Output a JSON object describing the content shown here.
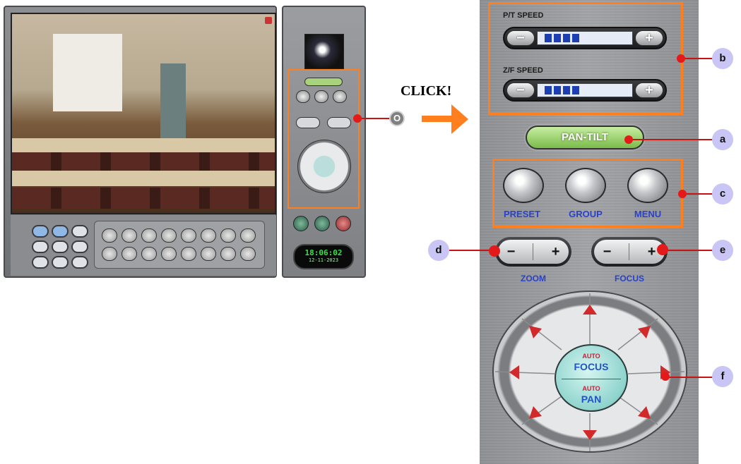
{
  "annotation": {
    "click_label": "CLICK!",
    "o_marker": "O",
    "markers": {
      "a": "a",
      "b": "b",
      "c": "c",
      "d": "d",
      "e": "e",
      "f": "f"
    },
    "colors": {
      "highlight": "#ff7f1f",
      "callout": "#e41a1a",
      "marker_bg": "#c9c5f4",
      "arrow": "#ff7f1f"
    }
  },
  "viewer": {
    "clock_time": "18:06:02",
    "clock_date": "12-11-2023"
  },
  "control_panel": {
    "pt_speed_label": "P/T SPEED",
    "zf_speed_label": "Z/F SPEED",
    "minus": "−",
    "plus": "+",
    "pt_speed_level": 0.45,
    "zf_speed_level": 0.45,
    "pan_tilt_label": "PAN-TILT",
    "preset_label": "PRESET",
    "group_label": "GROUP",
    "menu_label": "MENU",
    "zoom_label": "ZOOM",
    "focus_label": "FOCUS",
    "auto_focus_top": "AUTO",
    "auto_focus_bottom": "FOCUS",
    "auto_pan_top": "AUTO",
    "auto_pan_bottom": "PAN"
  }
}
